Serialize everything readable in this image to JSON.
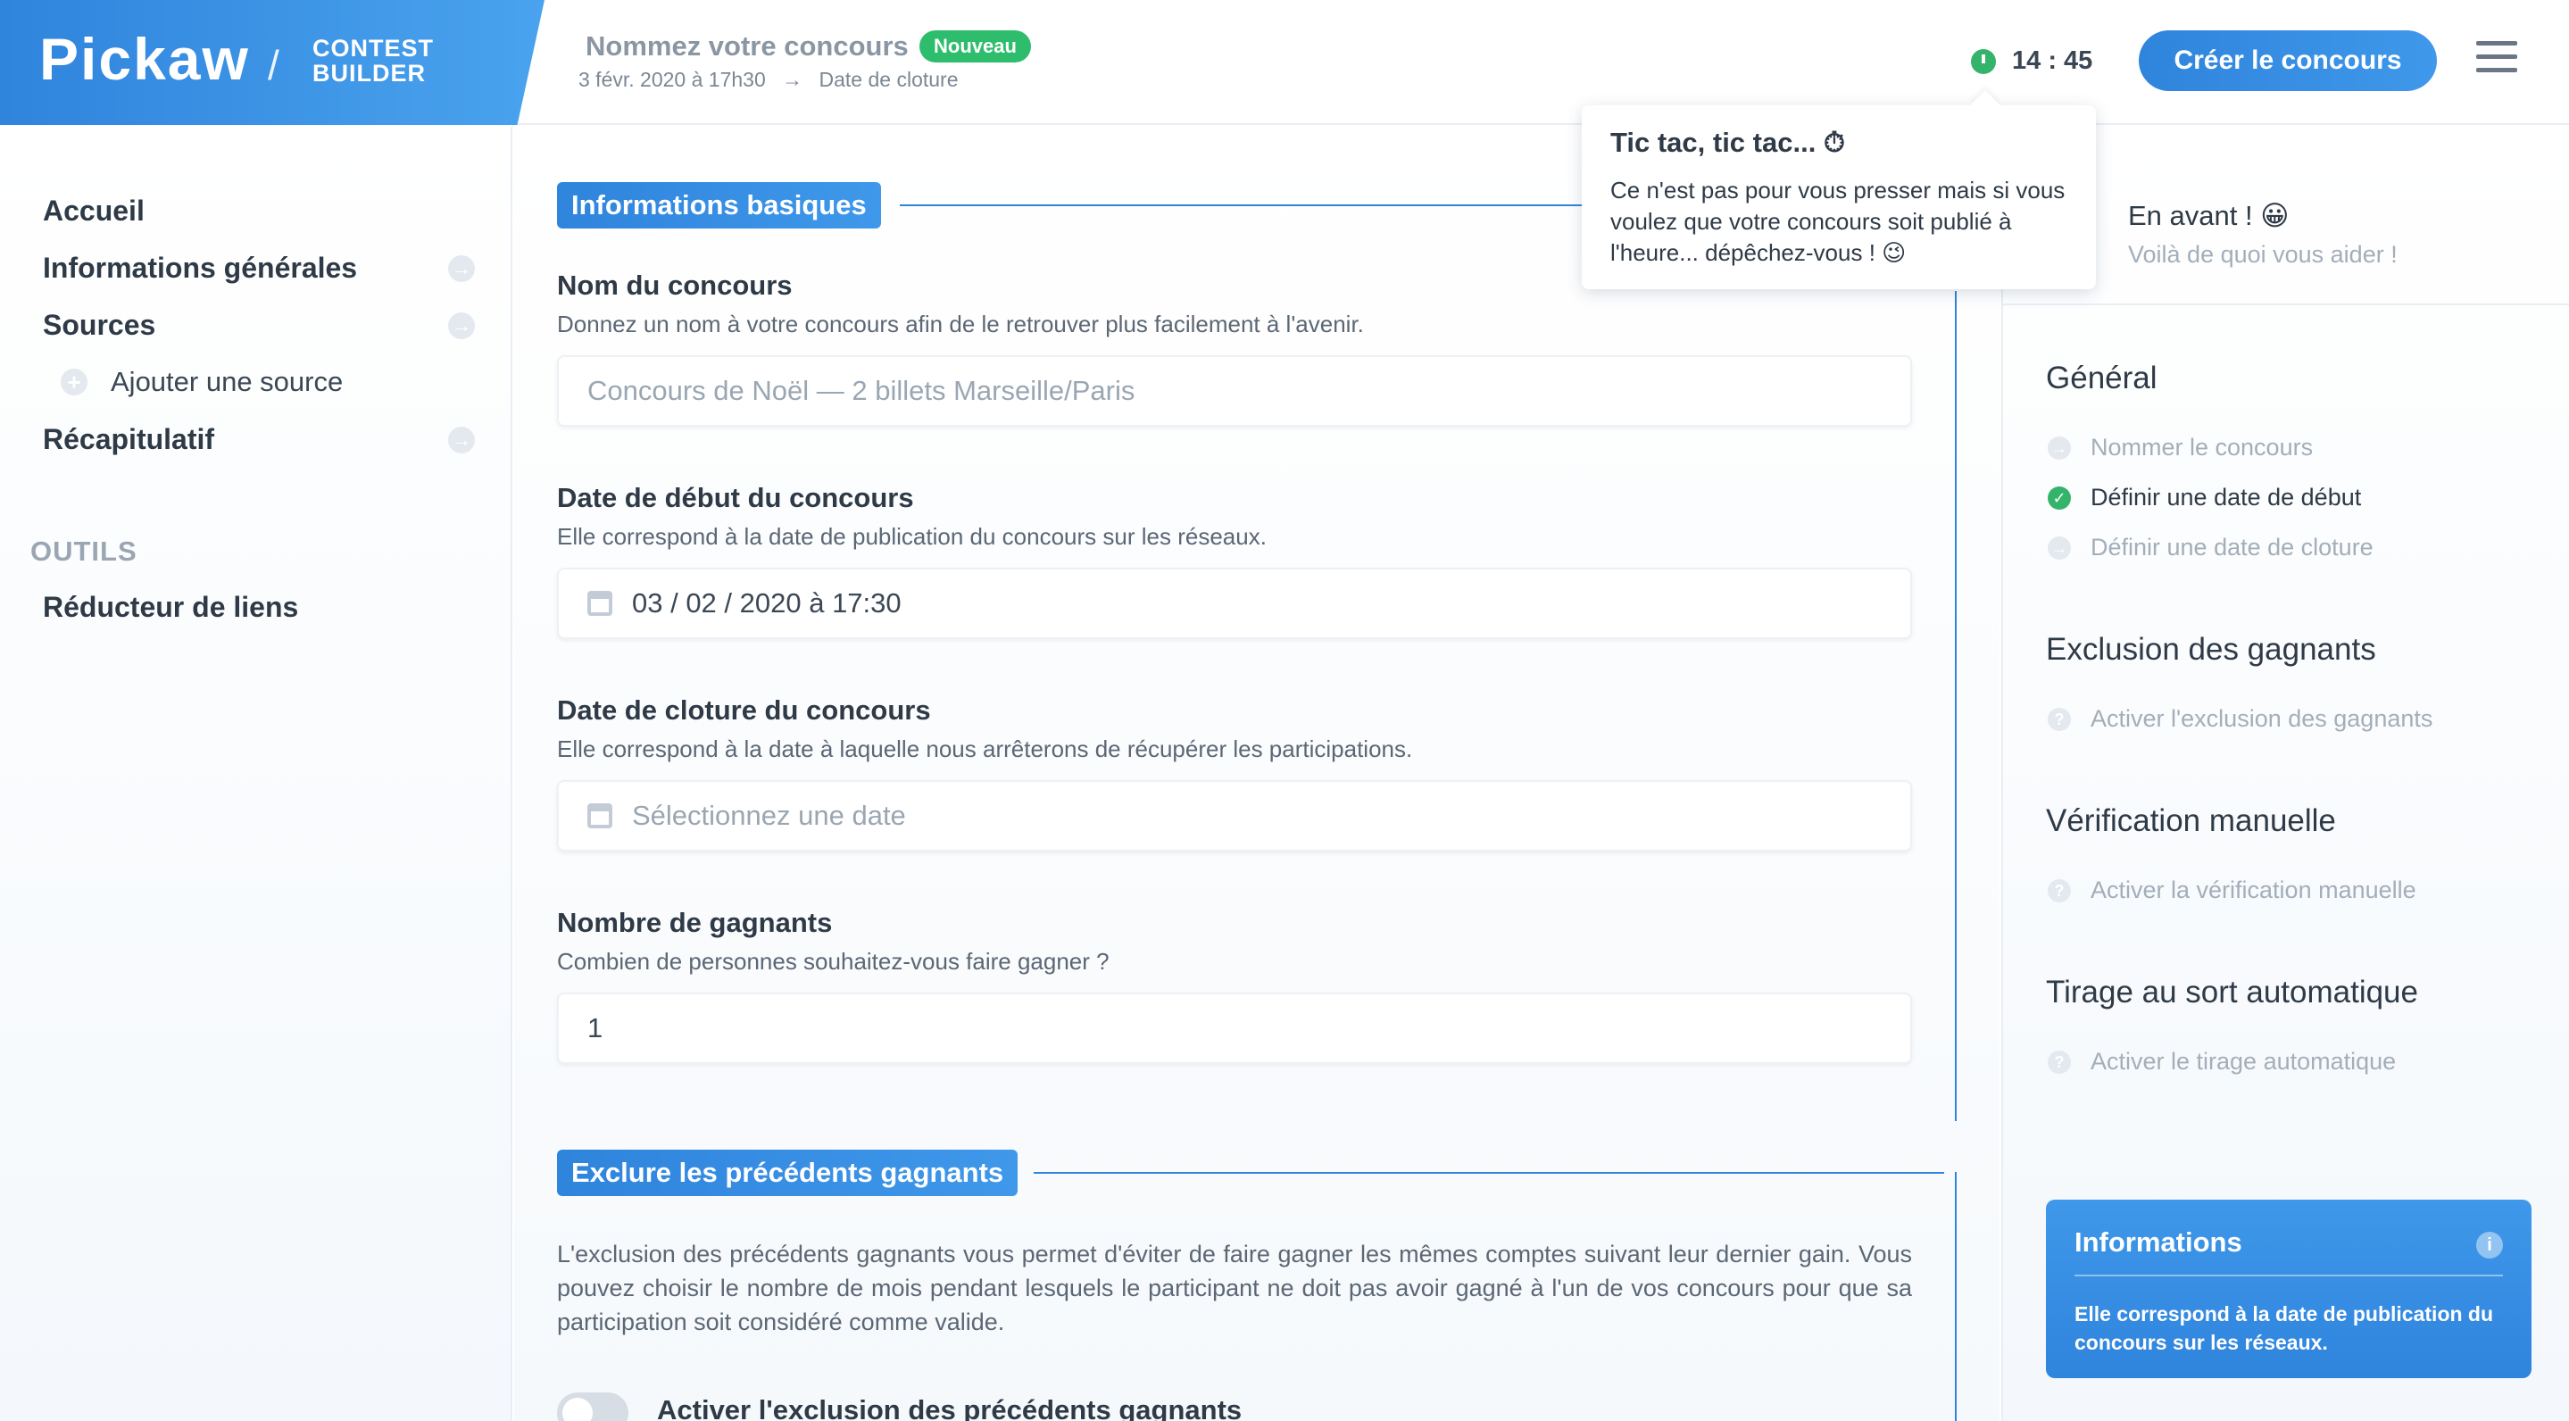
{
  "header": {
    "logo_text": "Pickaw",
    "logo_separator": "/",
    "logo_sub_line1": "CONTEST",
    "logo_sub_line2": "BUILDER",
    "contest_title": "Nommez votre concours",
    "badge": "Nouveau",
    "start_date": "3 févr. 2020 à 17h30",
    "arrow": "→",
    "end_date": "Date de cloture",
    "timer": "14 : 45",
    "create_button": "Créer le concours"
  },
  "sidebar": {
    "items": [
      {
        "label": "Accueil"
      },
      {
        "label": "Informations générales"
      },
      {
        "label": "Sources"
      },
      {
        "label": "Ajouter une source"
      },
      {
        "label": "Récapitulatif"
      }
    ],
    "tools_title": "OUTILS",
    "tools_items": [
      {
        "label": "Réducteur de liens"
      }
    ],
    "arrow_glyph": "→",
    "plus_glyph": "+"
  },
  "main": {
    "section1_title": "Informations basiques",
    "fields": [
      {
        "label": "Nom du concours",
        "help": "Donnez un nom à votre concours afin de le retrouver plus facilement à l'avenir.",
        "placeholder": "Concours de Noël — 2 billets Marseille/Paris"
      },
      {
        "label": "Date de début du concours",
        "help": "Elle correspond à la date de publication du concours sur les réseaux.",
        "value": "03 / 02 / 2020 à 17:30"
      },
      {
        "label": "Date de cloture du concours",
        "help": "Elle correspond à la date à laquelle nous arrêterons de récupérer les participations.",
        "placeholder": "Sélectionnez une date"
      },
      {
        "label": "Nombre de gagnants",
        "help": "Combien de personnes souhaitez-vous faire gagner ?",
        "value": "1"
      }
    ],
    "section2_title": "Exclure les précédents gagnants",
    "section2_text": "L'exclusion des précédents gagnants vous permet d'éviter de faire gagner les mêmes comptes suivant leur dernier gain. Vous pouvez choisir le nombre de mois pendant lesquels le participant ne doit pas avoir gagné à l'un de vos concours pour que sa participation soit considéré comme valide.",
    "toggle_label": "Activer l'exclusion des précédents gagnants"
  },
  "tooltip": {
    "title": "Tic tac, tic tac... ⏱",
    "text": "Ce n'est pas pour vous presser mais si vous voulez que votre concours soit publié à l'heure... dépêchez-vous ! 😉"
  },
  "right": {
    "greeting": "En avant ! 😀",
    "greeting_sub": "Voilà de quoi vous aider !",
    "groups": [
      {
        "title": "Général",
        "steps": [
          {
            "label": "Nommer le concours",
            "state": "todo"
          },
          {
            "label": "Définir une date de début",
            "state": "done"
          },
          {
            "label": "Définir une date de cloture",
            "state": "todo"
          }
        ]
      },
      {
        "title": "Exclusion des gagnants",
        "steps": [
          {
            "label": "Activer l'exclusion des gagnants",
            "state": "optional"
          }
        ]
      },
      {
        "title": "Vérification manuelle",
        "steps": [
          {
            "label": "Activer la vérification manuelle",
            "state": "optional"
          }
        ]
      },
      {
        "title": "Tirage au sort automatique",
        "steps": [
          {
            "label": "Activer le tirage automatique",
            "state": "optional"
          }
        ]
      }
    ],
    "step_glyphs": {
      "todo": "→",
      "done": "✓",
      "optional": "?"
    },
    "info_card": {
      "title": "Informations",
      "icon": "i",
      "text": "Elle correspond à la date de publication du concours sur les réseaux."
    }
  },
  "colors": {
    "brand_blue": "#2f84dc",
    "success_green": "#2ebd6c",
    "muted_gray": "#a3aeb9"
  }
}
